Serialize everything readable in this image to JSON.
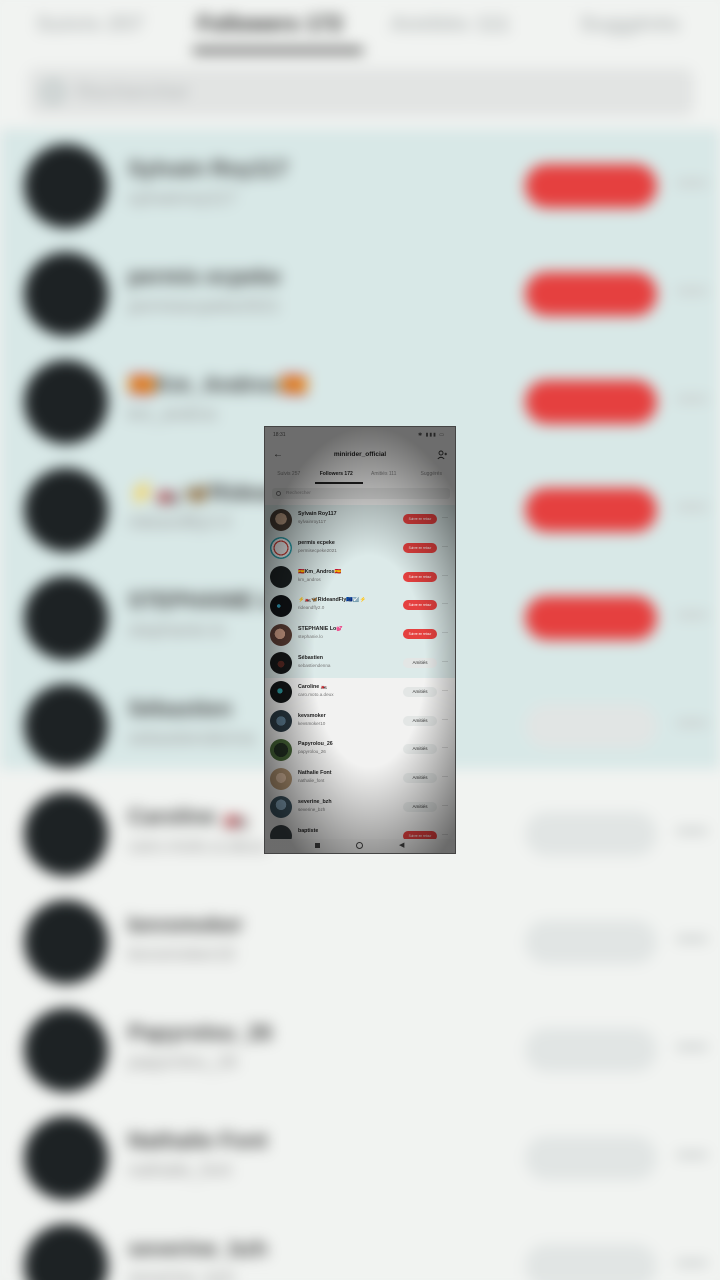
{
  "header": {
    "title": "minirider_official",
    "time": "18:31",
    "status_icons": "✱ ▮▮▮ ▭"
  },
  "tabs": [
    {
      "label": "Suivis 257"
    },
    {
      "label": "Followers 172"
    },
    {
      "label": "Amitiés 111"
    },
    {
      "label": "Suggérés"
    }
  ],
  "search": {
    "placeholder": "Rechercher"
  },
  "buttons": {
    "follow_back": "Suivre en retour",
    "friends": "Amitiés"
  },
  "followers": [
    {
      "name": "Sylvain Roy117",
      "username": "sylvainroy117",
      "button": "Suivre en retour",
      "highlighted": true
    },
    {
      "name": "permis ecpeke",
      "username": "permisecpeke2021",
      "button": "Suivre en retour",
      "highlighted": true
    },
    {
      "name": "🇪🇸Km_Andros🇪🇸",
      "username": "km_andros",
      "button": "Suivre en retour",
      "highlighted": true
    },
    {
      "name": "⚡🏍️🦋RideandFly🇪🇺☑️⚡",
      "username": "rideandfly2.0",
      "button": "Suivre en retour",
      "highlighted": true
    },
    {
      "name": "STEPHANIE Lo💕",
      "username": "stephanie.lo",
      "button": "Suivre en retour",
      "highlighted": true
    },
    {
      "name": "Sébastien",
      "username": "sebastiendenna",
      "button": "Amitiés",
      "highlighted": true
    },
    {
      "name": "Caroline 🏍️",
      "username": "caro.moto.a.deux",
      "button": "Amitiés",
      "highlighted": false
    },
    {
      "name": "kevsmoker",
      "username": "kevsmoker10",
      "button": "Amitiés",
      "highlighted": false
    },
    {
      "name": "Papyrolou_26",
      "username": "papyrolou_26",
      "button": "Amitiés",
      "highlighted": false
    },
    {
      "name": "Nathalie Font",
      "username": "nathalie_font",
      "button": "Amitiés",
      "highlighted": false
    },
    {
      "name": "severine_bzh",
      "username": "severine_bzh",
      "button": "Amitiés",
      "highlighted": false
    },
    {
      "name": "baptiste",
      "username": "",
      "button": "Suivre en retour",
      "highlighted": false
    }
  ],
  "background": {
    "tabs": [
      "Suivis 257",
      "Followers 172",
      "Amitiés 111",
      "Suggérés"
    ],
    "search_placeholder": "Rechercher",
    "rows": [
      {
        "name": "Sylvain Roy117",
        "username": "sylvainroy117",
        "button_color": "#e5403f"
      },
      {
        "name": "permis ecpeke",
        "username": "permisecpeke2021",
        "button_color": "#e5403f"
      },
      {
        "name": "🇪🇸Km_Andros🇪🇸",
        "username": "km_andros",
        "button_color": "#e5403f"
      },
      {
        "name": "⚡🏍️🦋RideandFly",
        "username": "rideandfly2.0",
        "button_color": "#e5403f"
      },
      {
        "name": "STEPHANIE Lo",
        "username": "stephanie.lo",
        "button_color": "#e5403f"
      },
      {
        "name": "Sébastien",
        "username": "sebastiendenna",
        "button_color": "#e1e5e4"
      },
      {
        "name": "Caroline 🏍️",
        "username": "caro.moto.a.deux",
        "button_color": "#e1e5e4"
      },
      {
        "name": "kevsmoker",
        "username": "kevsmoker10",
        "button_color": "#e1e5e4"
      },
      {
        "name": "Papyrolou_26",
        "username": "papyrolou_26",
        "button_color": "#e1e5e4"
      },
      {
        "name": "Nathalie Font",
        "username": "nathalie_font",
        "button_color": "#e1e5e4"
      },
      {
        "name": "severine_bzh",
        "username": "severine_bzh",
        "button_color": "#e1e5e4"
      }
    ]
  },
  "colors": {
    "accent_red": "#e5403f",
    "highlight_row": "#dceae9",
    "friends_button": "#e3e6e5"
  },
  "nav": {
    "back_glyph": "◀"
  }
}
